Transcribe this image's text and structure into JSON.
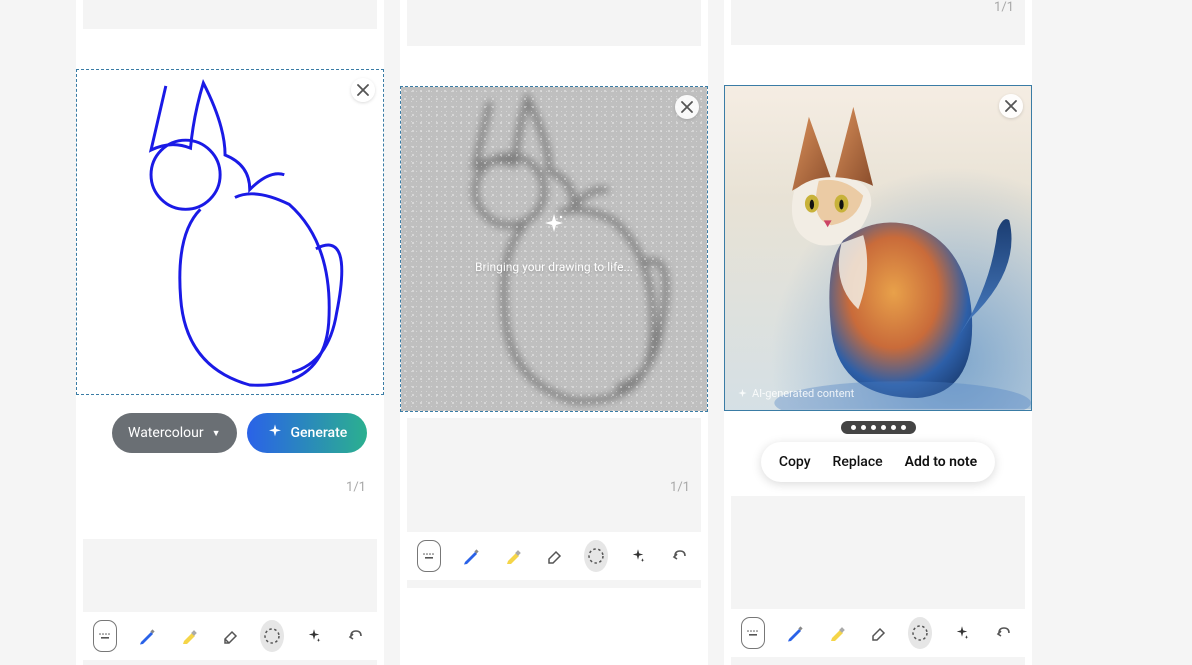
{
  "panel1": {
    "style_label": "Watercolour",
    "generate_label": "Generate",
    "page_counter": "1/1"
  },
  "panel2": {
    "loading_text": "Bringing your drawing to life...",
    "page_counter": "1/1"
  },
  "panel3": {
    "ai_label": "AI-generated content",
    "dots_count": 6,
    "actions": {
      "copy": "Copy",
      "replace": "Replace",
      "add": "Add to note"
    },
    "page_counter": "1/1"
  },
  "toolbar": {
    "keyboard": "keyboard-icon",
    "pen": "pen-icon",
    "highlighter": "highlighter-icon",
    "eraser": "eraser-icon",
    "lasso": "lasso-icon",
    "ai": "ai-sparkle-icon",
    "undo": "undo-icon"
  }
}
